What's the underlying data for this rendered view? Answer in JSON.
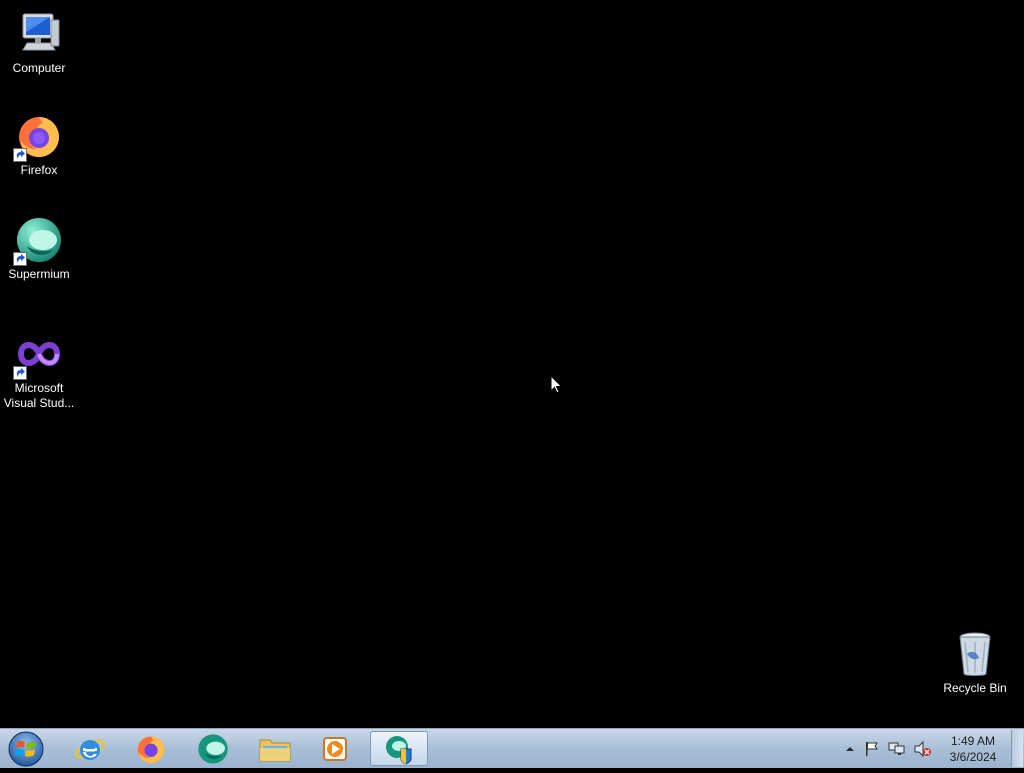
{
  "desktop": {
    "icons": [
      {
        "label": "Computer",
        "icon": "computer-icon"
      },
      {
        "label": "Firefox",
        "icon": "firefox-icon"
      },
      {
        "label": "Supermium",
        "icon": "supermium-icon"
      },
      {
        "label": "Microsoft Visual Stud...",
        "label_line1": "Microsoft",
        "label_line2": "Visual Stud...",
        "icon": "visual-studio-icon"
      },
      {
        "label": "Recycle Bin",
        "icon": "recycle-bin-icon"
      }
    ]
  },
  "taskbar": {
    "start": {
      "icon": "windows-start-orb-icon"
    },
    "pinned": [
      {
        "name": "Internet Explorer",
        "icon": "internet-explorer-icon"
      },
      {
        "name": "Firefox",
        "icon": "firefox-icon"
      },
      {
        "name": "Supermium",
        "icon": "supermium-icon"
      },
      {
        "name": "Windows Explorer",
        "icon": "folder-icon"
      },
      {
        "name": "Windows Media Player",
        "icon": "media-player-icon"
      },
      {
        "name": "Supermium (active)",
        "icon": "supermium-installer-icon"
      }
    ],
    "tray": {
      "icons": [
        "show-hidden-icons-arrow",
        "action-center-flag-icon",
        "network-icon",
        "volume-muted-icon"
      ]
    },
    "clock": {
      "time": "1:49 AM",
      "date": "3/6/2024"
    }
  },
  "colors": {
    "desktop_bg": "#000000",
    "taskbar": "#a9bfd6"
  }
}
